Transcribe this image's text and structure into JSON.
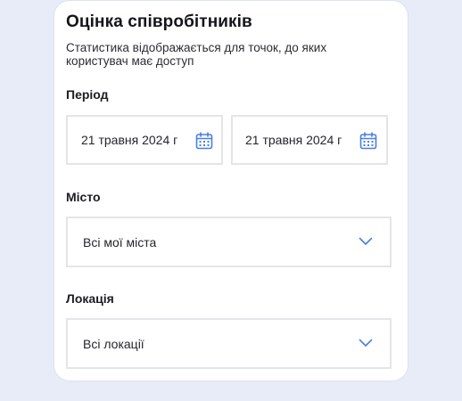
{
  "title": "Оцінка співробітників",
  "subtitle": "Статистика відображається для точок, до яких користувач має доступ",
  "period": {
    "label": "Період",
    "start_date": "21 травня 2024 г",
    "end_date": "21 травня 2024 г",
    "icon": "calendar-icon"
  },
  "city": {
    "label": "Місто",
    "selected": "Всі мої міста",
    "icon": "chevron-down-icon"
  },
  "location": {
    "label": "Локація",
    "selected": "Всі локації",
    "icon": "chevron-down-icon"
  },
  "colors": {
    "background": "#e8ecf8",
    "card": "#ffffff",
    "field_border": "#e3e5eb",
    "accent": "#4a7fe0"
  }
}
